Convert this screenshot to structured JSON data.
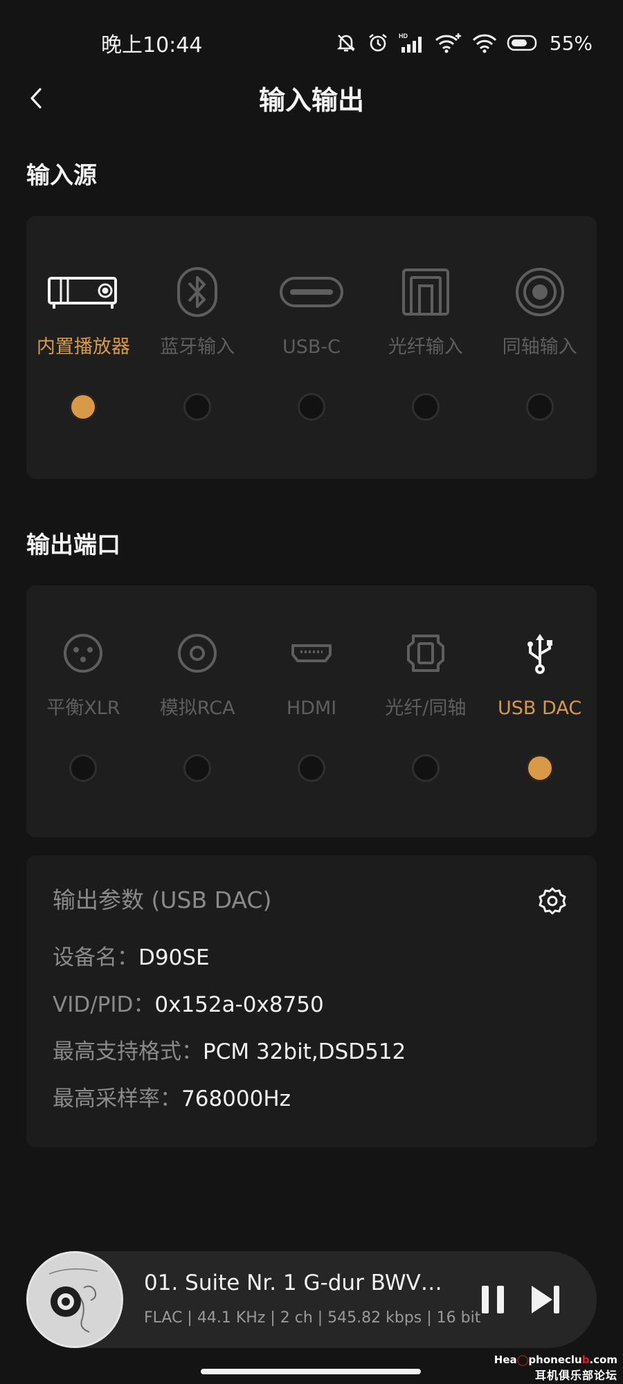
{
  "status_bar": {
    "time": "晚上10:44",
    "battery": "55%",
    "icons": [
      "mute-bell-icon",
      "alarm-icon",
      "hd-signal-icon",
      "wifi-plus-icon",
      "wifi-icon",
      "battery-icon"
    ]
  },
  "header": {
    "title": "输入输出",
    "back_icon": "chevron-left-icon"
  },
  "input_section": {
    "title": "输入源",
    "options": [
      {
        "label": "内置播放器",
        "icon": "player-device-icon",
        "selected": true
      },
      {
        "label": "蓝牙输入",
        "icon": "bluetooth-icon",
        "selected": false
      },
      {
        "label": "USB-C",
        "icon": "usb-c-icon",
        "selected": false
      },
      {
        "label": "光纤输入",
        "icon": "optical-icon",
        "selected": false
      },
      {
        "label": "同轴输入",
        "icon": "coaxial-icon",
        "selected": false
      }
    ]
  },
  "output_section": {
    "title": "输出端口",
    "options": [
      {
        "label": "平衡XLR",
        "icon": "xlr-icon",
        "selected": false
      },
      {
        "label": "模拟RCA",
        "icon": "rca-icon",
        "selected": false
      },
      {
        "label": "HDMI",
        "icon": "hdmi-icon",
        "selected": false
      },
      {
        "label": "光纤/同轴",
        "icon": "optical-coax-icon",
        "selected": false
      },
      {
        "label": "USB DAC",
        "icon": "usb-icon",
        "selected": true
      }
    ]
  },
  "output_params": {
    "title": "输出参数 (USB DAC)",
    "settings_icon": "gear-icon",
    "rows": [
      {
        "key": "设备名：",
        "value": "D90SE"
      },
      {
        "key": "VID/PID：",
        "value": "0x152a-0x8750"
      },
      {
        "key": "最高支持格式：",
        "value": "PCM 32bit,DSD512"
      },
      {
        "key": "最高采样率：",
        "value": "768000Hz"
      }
    ]
  },
  "player": {
    "title": "01. Suite Nr. 1 G-dur BWV 1...",
    "meta": "FLAC | 44.1 KHz | 2 ch | 545.82 kbps | 16 bit",
    "state": "playing"
  },
  "watermark": {
    "line1_a": "Hea",
    "line1_b": "phoneclu",
    "line1_c": ".com",
    "line2": "耳机俱乐部论坛"
  },
  "colors": {
    "accent": "#d89a47",
    "background": "#141414",
    "card": "#1e1e1e",
    "inactive": "#5e5e5e"
  }
}
